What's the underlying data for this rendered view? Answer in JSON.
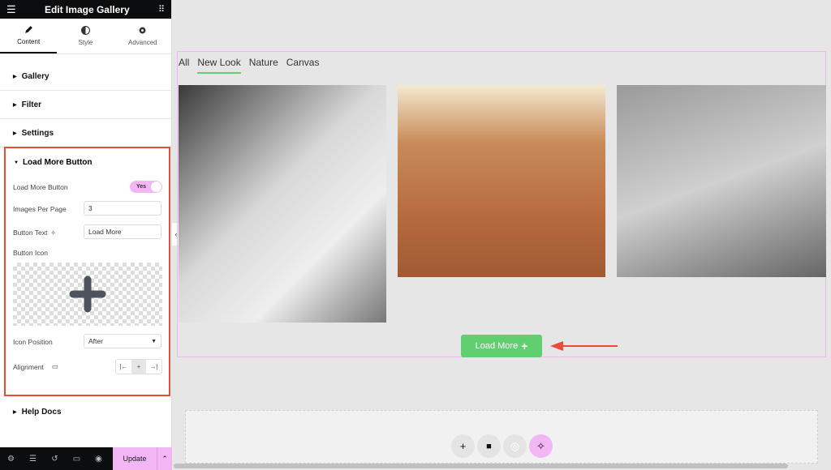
{
  "panel": {
    "title": "Edit Image Gallery",
    "tabs": [
      {
        "label": "Content",
        "icon": "pencil-icon"
      },
      {
        "label": "Style",
        "icon": "contrast-icon"
      },
      {
        "label": "Advanced",
        "icon": "gear-icon"
      }
    ],
    "sections": [
      "Gallery",
      "Filter",
      "Settings"
    ],
    "load_more": {
      "heading": "Load More Button",
      "toggle_label": "Load More Button",
      "toggle_value": "Yes",
      "images_per_page_label": "Images Per Page",
      "images_per_page": "3",
      "button_text_label": "Button Text",
      "button_text": "Load More",
      "button_icon_label": "Button Icon",
      "icon_position_label": "Icon Position",
      "icon_position": "After",
      "alignment_label": "Alignment",
      "alignment_options": [
        "left",
        "center",
        "right"
      ],
      "alignment_selected": "center"
    },
    "help": "Help Docs",
    "footer": {
      "update": "Update"
    }
  },
  "gallery": {
    "filters": [
      "All",
      "New Look",
      "Nature",
      "Canvas"
    ],
    "active_filter": "New Look",
    "load_more_label": "Load More",
    "accent": "#61ce70"
  }
}
